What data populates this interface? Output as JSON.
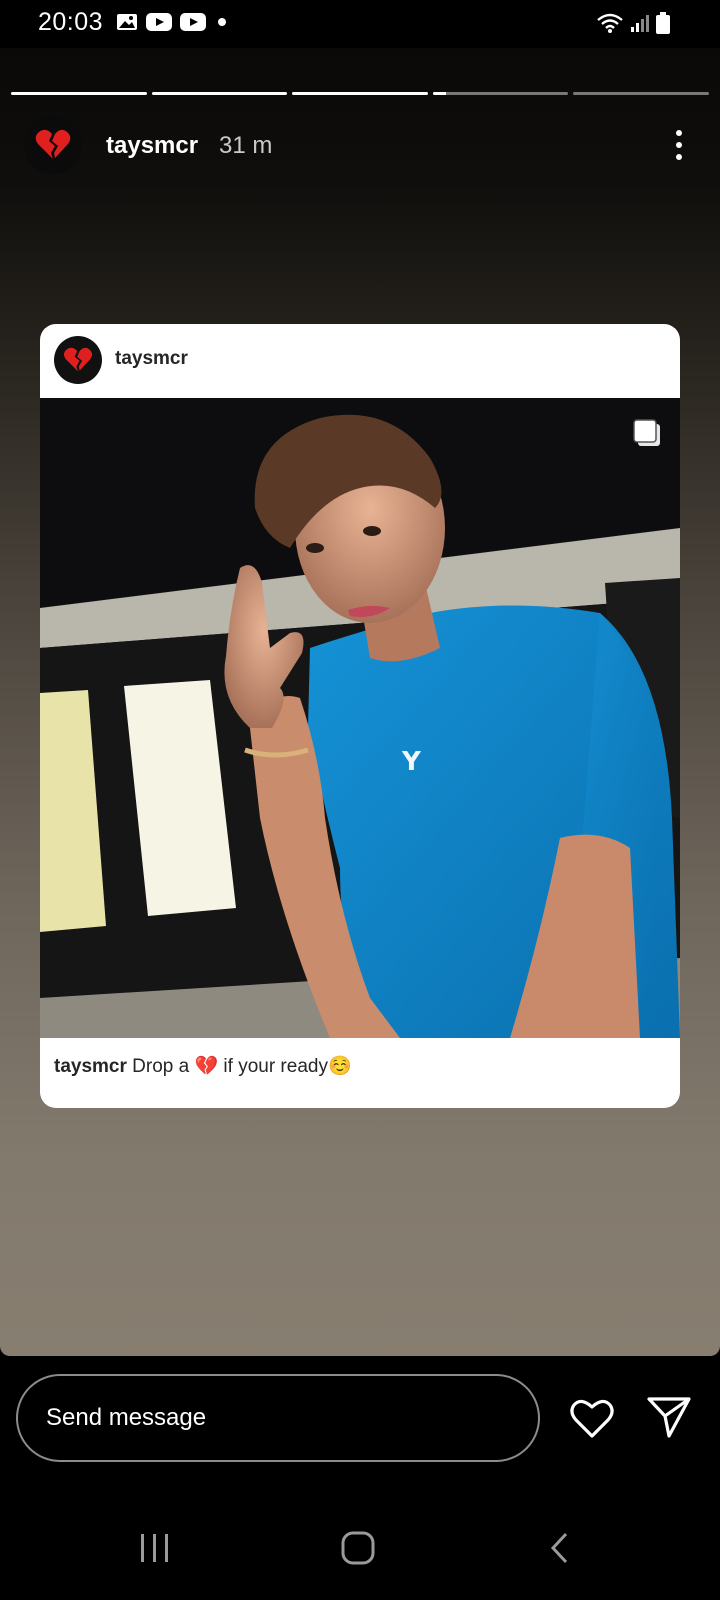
{
  "status_bar": {
    "time": "20:03",
    "left_icons": [
      "gallery-icon",
      "youtube-icon",
      "youtube-icon",
      "notification-dot-icon"
    ],
    "right_icons": [
      "wifi-icon",
      "signal-icon",
      "battery-icon"
    ]
  },
  "story": {
    "progress_segments": [
      1,
      1,
      1,
      0.1,
      0
    ],
    "username": "taysmcr",
    "time_ago": "31 m",
    "avatar_emoji": "💔"
  },
  "post": {
    "username": "taysmcr",
    "avatar_emoji": "💔",
    "caption_user": "taysmcr",
    "caption_text": "Drop a 💔 if your ready☺️",
    "shirt_logo": "Y"
  },
  "bottom_bar": {
    "placeholder": "Send message"
  },
  "colors": {
    "shirt": "#0e86c7",
    "story_bg_bottom": "#877e70"
  }
}
